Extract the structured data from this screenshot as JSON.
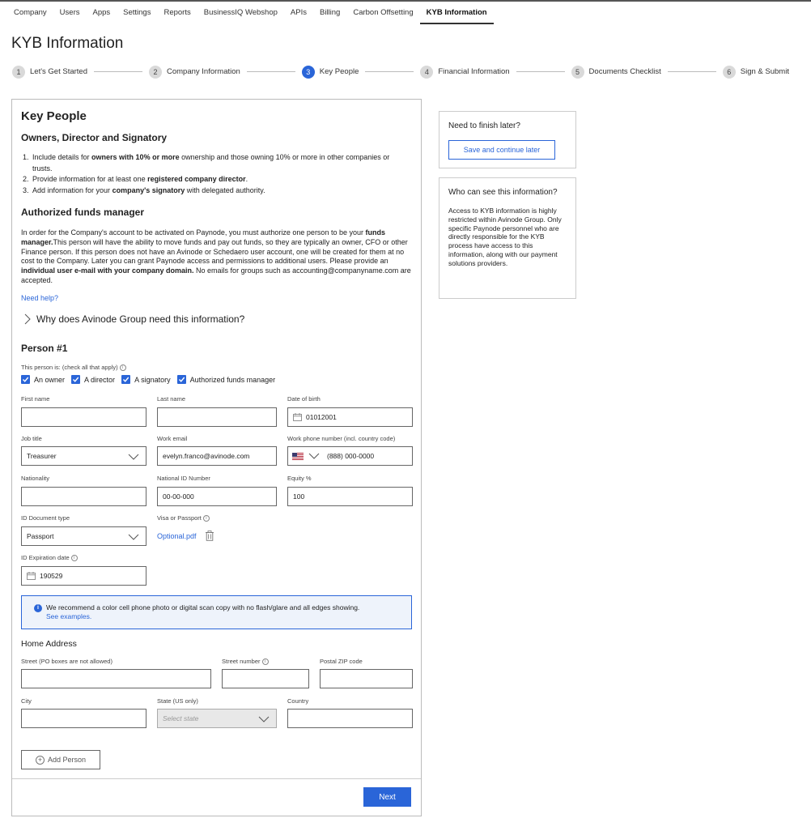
{
  "topnav": [
    "Company",
    "Users",
    "Apps",
    "Settings",
    "Reports",
    "BusinessIQ Webshop",
    "APIs",
    "Billing",
    "Carbon Offsetting",
    "KYB Information"
  ],
  "page_title": "KYB Information",
  "steps": [
    {
      "num": "1",
      "label": "Let's Get Started"
    },
    {
      "num": "2",
      "label": "Company Information"
    },
    {
      "num": "3",
      "label": "Key People"
    },
    {
      "num": "4",
      "label": "Financial Information"
    },
    {
      "num": "5",
      "label": "Documents Checklist"
    },
    {
      "num": "6",
      "label": "Sign & Submit"
    }
  ],
  "main": {
    "title": "Key People",
    "owners_heading": "Owners, Director and Signatory",
    "list": [
      {
        "num": "1.",
        "pre": "Include details for ",
        "bold": "owners with 10% or more",
        "post": " ownership and those owning 10% or more in other companies or trusts."
      },
      {
        "num": "2.",
        "pre": "Provide information for at least one ",
        "bold": "registered company director",
        "post": "."
      },
      {
        "num": "3.",
        "pre": "Add information for your ",
        "bold": "company's signatory",
        "post": " with delegated authority."
      }
    ],
    "funds_heading": "Authorized funds manager",
    "funds_p1": "In order for the Company's account to be activated on Paynode, you must authorize one person to be your ",
    "funds_b1": "funds manager.",
    "funds_p2": "This person will have the ability to move funds and pay out funds, so they are typically an owner, CFO or other Finance person. If this person does not have an Avinode or Schedaero user account, one will be created for them at no cost to the Company. Later you can grant Paynode access and permissions to additional users. Please provide an ",
    "funds_b2": "individual user e-mail with your company domain.",
    "funds_p3": " No emails for groups such as accounting@companyname.com are accepted.",
    "need_help": "Need help?",
    "why_label": "Why does Avinode Group need this information?",
    "person_heading": "Person #1",
    "person_is_label": "This person is: (check all that apply)",
    "checkboxes": [
      "An owner",
      "A director",
      "A signatory",
      "Authorized funds manager"
    ],
    "labels": {
      "first_name": "First name",
      "last_name": "Last name",
      "dob": "Date of birth",
      "job_title": "Job title",
      "work_email": "Work email",
      "work_phone": "Work phone number (incl. country code)",
      "nationality": "Nationality",
      "national_id": "National ID Number",
      "equity": "Equity %",
      "id_doc_type": "ID Document type",
      "visa": "Visa or Passport",
      "id_expiration": "ID Expiration date",
      "street": "Street (PO boxes are not allowed)",
      "street_number": "Street number",
      "postal": "Postal ZIP code",
      "city": "City",
      "state": "State (US only)",
      "country": "Country"
    },
    "values": {
      "first_name": "",
      "last_name": "",
      "dob": "01012001",
      "job_title": "Treasurer",
      "work_email": "evelyn.franco@avinode.com",
      "work_phone": "(888) 000-0000",
      "nationality": "",
      "national_id": "00-00-000",
      "equity": "100",
      "id_doc_type": "Passport",
      "visa_file": "Optional.pdf",
      "id_expiration": "190529",
      "street": "",
      "street_number": "",
      "postal": "",
      "city": "",
      "state_placeholder": "Select state",
      "country": ""
    },
    "notice_text": "We recommend a color cell phone photo or digital scan copy with no flash/glare and all edges showing.",
    "notice_link": "See examples.",
    "home_heading": "Home Address",
    "add_person": "Add Person",
    "next": "Next"
  },
  "side": {
    "finish_title": "Need to finish later?",
    "save_button": "Save and continue later",
    "who_title": "Who can see this information?",
    "who_text": "Access to KYB information is highly restricted within Avinode Group. Only specific Paynode personnel who are directly responsible for the KYB process have access to this information, along with our payment solutions providers."
  },
  "colors": {
    "accent": "#2a65d8"
  }
}
